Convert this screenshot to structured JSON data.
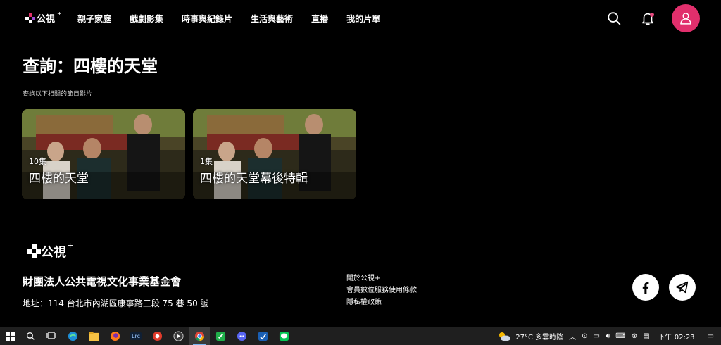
{
  "header": {
    "logo_text": "公視",
    "logo_plus": "+",
    "nav": [
      {
        "label": "親子家庭"
      },
      {
        "label": "戲劇影集"
      },
      {
        "label": "時事與紀錄片"
      },
      {
        "label": "生活與藝術"
      },
      {
        "label": "直播"
      },
      {
        "label": "我的片單"
      }
    ],
    "icons": [
      "search-icon",
      "bell-icon",
      "user-icon"
    ],
    "accent_color": "#e12f6c"
  },
  "main": {
    "title": "查詢：四樓的天堂",
    "subtitle": "查詢以下相關的節目影片",
    "cards": [
      {
        "episodes": "10集",
        "title": "四樓的天堂"
      },
      {
        "episodes": "1集",
        "title": "四樓的天堂幕後特輯"
      }
    ]
  },
  "footer": {
    "logo_text": "公視",
    "logo_plus": "+",
    "org_name": "財團法人公共電視文化事業基金會",
    "address": "地址：114 台北市內湖區康寧路三段 75 巷 50 號",
    "links": [
      {
        "label": "關於公視+"
      },
      {
        "label": "會員數位服務使用條款"
      },
      {
        "label": "隱私權政策"
      }
    ],
    "social": [
      "facebook-icon",
      "telegram-icon"
    ]
  },
  "taskbar": {
    "apps": [
      "windows-start-icon",
      "search-icon",
      "task-view-icon",
      "edge-icon",
      "file-explorer-icon",
      "firefox-icon",
      "lrc-icon",
      "app-icon",
      "app-icon",
      "chrome-icon",
      "app-icon",
      "discord-icon",
      "app-icon",
      "line-icon"
    ],
    "lrc_label": "Lrc",
    "weather": "27°C 多雲時陰",
    "time": "下午 02:23"
  }
}
